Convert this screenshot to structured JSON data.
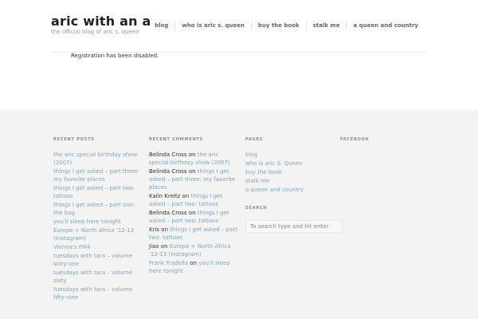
{
  "header": {
    "site_title": "aric with an a",
    "tagline": "the official blog of aric s. queen",
    "nav": [
      "blog",
      "who is aric s. queen",
      "buy the book",
      "stalk me",
      "a queen and country"
    ]
  },
  "notice": "Registration has been disabled.",
  "footer": {
    "recent_posts": {
      "title": "RECENT POSTS",
      "items": [
        "the aric special birthday show (2007)",
        "things I get asked – part three: my favorite places",
        "things I get asked – part two: tattoos",
        "things I get asked – part one: the bag",
        "you'll sleep here tonight",
        "Europe + North Africa '12-13 (Instagram)",
        "Vienna's FM4",
        "tuesdays with tara – volume sixty-one",
        "tuesdays with tara – volume sixty",
        "tuesdays with tara – volume fifty-nine"
      ]
    },
    "recent_comments": {
      "title": "RECENT COMMENTS",
      "on_word": "on",
      "items": [
        {
          "author": "Belinda Cross",
          "post": "the aric special birthday show (2007)"
        },
        {
          "author": "Belinda Cross",
          "post": "things I get asked – part three: my favorite places"
        },
        {
          "author": "Kailn Kreitz",
          "post": "things I get asked – part two: tattoos"
        },
        {
          "author": "Belinda Cross",
          "post": "things I get asked – part two: tattoos"
        },
        {
          "author": "Kris",
          "post": "things I get asked – part two: tattoos"
        },
        {
          "author": "Jiao",
          "post": "Europe + North Africa '12-13 (Instagram)"
        },
        {
          "author": "Frank Fradella",
          "post": "you'll sleep here tonight"
        }
      ]
    },
    "pages": {
      "title": "PAGES",
      "items": [
        "blog",
        "who is aric S. Queen",
        "buy the book",
        "stalk me",
        "a queen and country"
      ]
    },
    "search": {
      "title": "SEARCH",
      "placeholder": "To search type and hit enter"
    },
    "facebook": {
      "title": "FACEBOOK"
    }
  }
}
